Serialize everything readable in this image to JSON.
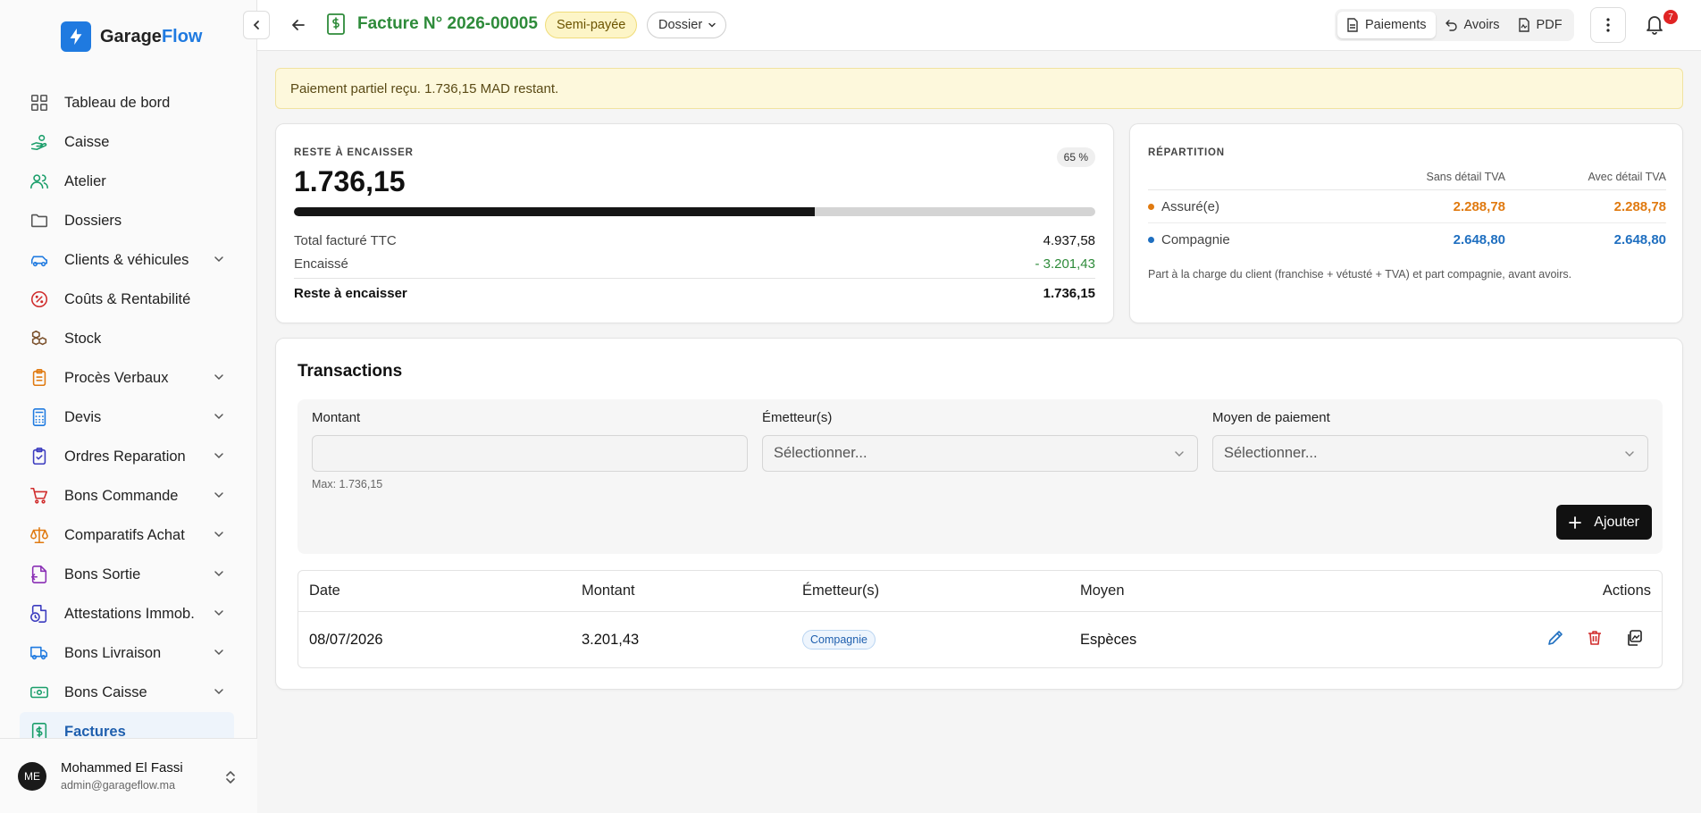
{
  "app": {
    "brand_1": "Garage",
    "brand_2": "Flow",
    "accent": "#1f7ae0"
  },
  "sidebar": {
    "items": [
      {
        "label": "Tableau de bord",
        "icon": "dashboard-icon",
        "color": "#555555",
        "chevron": false
      },
      {
        "label": "Caisse",
        "icon": "cash-hand-icon",
        "color": "#1a9e6a",
        "chevron": false
      },
      {
        "label": "Atelier",
        "icon": "users-icon",
        "color": "#1a9e6a",
        "chevron": false
      },
      {
        "label": "Dossiers",
        "icon": "folder-icon",
        "color": "#555555",
        "chevron": false
      },
      {
        "label": "Clients & véhicules",
        "icon": "car-icon",
        "color": "#1f7ae0",
        "chevron": true
      },
      {
        "label": "Coûts & Rentabilité",
        "icon": "percent-icon",
        "color": "#d02c2c",
        "chevron": false
      },
      {
        "label": "Stock",
        "icon": "boxes-icon",
        "color": "#7a4f2a",
        "chevron": false
      },
      {
        "label": "Procès Verbaux",
        "icon": "clipboard-list-icon",
        "color": "#e07a10",
        "chevron": true
      },
      {
        "label": "Devis",
        "icon": "calculator-icon",
        "color": "#1f7ae0",
        "chevron": true
      },
      {
        "label": "Ordres Reparation",
        "icon": "clipboard-check-icon",
        "color": "#3b3bbf",
        "chevron": true
      },
      {
        "label": "Bons Commande",
        "icon": "cart-icon",
        "color": "#d02c2c",
        "chevron": true
      },
      {
        "label": "Comparatifs Achat",
        "icon": "scale-icon",
        "color": "#e07a10",
        "chevron": true
      },
      {
        "label": "Bons Sortie",
        "icon": "file-export-icon",
        "color": "#8a2fb5",
        "chevron": true
      },
      {
        "label": "Attestations Immob.",
        "icon": "file-clock-icon",
        "color": "#3b3bbf",
        "chevron": true
      },
      {
        "label": "Bons Livraison",
        "icon": "truck-icon",
        "color": "#1f7ae0",
        "chevron": true
      },
      {
        "label": "Bons Caisse",
        "icon": "banknote-icon",
        "color": "#1a9e6a",
        "chevron": true
      },
      {
        "label": "Factures",
        "icon": "invoice-icon",
        "color": "#1a9e6a",
        "chevron": false,
        "active": true
      }
    ],
    "user": {
      "initials": "ME",
      "name": "Mohammed El Fassi",
      "email": "admin@garageflow.ma"
    }
  },
  "header": {
    "title": "Facture N° 2026-00005",
    "status": "Semi-payée",
    "dossier_label": "Dossier",
    "tabs": [
      {
        "label": "Paiements",
        "icon": "file-icon",
        "active": true
      },
      {
        "label": "Avoirs",
        "icon": "undo-icon",
        "active": false
      },
      {
        "label": "PDF",
        "icon": "pdf-icon",
        "active": false
      }
    ],
    "notifications": "7"
  },
  "alert": {
    "text": "Paiement partiel reçu. 1.736,15 MAD restant."
  },
  "balance": {
    "eyebrow": "RESTE À ENCAISSER",
    "percent_label": "65 %",
    "paid_fraction": 0.65,
    "amount": "1.736,15",
    "rows": {
      "total_label": "Total facturé TTC",
      "total_value": "4.937,58",
      "paid_label": "Encaissé",
      "paid_value": "- 3.201,43",
      "remaining_label": "Reste à encaisser",
      "remaining_value": "1.736,15"
    }
  },
  "repartition": {
    "eyebrow": "RÉPARTITION",
    "col1": "Sans détail TVA",
    "col2": "Avec détail TVA",
    "rows": [
      {
        "label": "Assuré(e)",
        "v1": "2.288,78",
        "v2": "2.288,78",
        "color": "#e07a10"
      },
      {
        "label": "Compagnie",
        "v1": "2.648,80",
        "v2": "2.648,80",
        "color": "#1f6fc0"
      }
    ],
    "note": "Part à la charge du client (franchise + vétusté + TVA) et part compagnie, avant avoirs."
  },
  "transactions": {
    "title": "Transactions",
    "form": {
      "amount_label": "Montant",
      "amount_value": "",
      "amount_hint": "Max: 1.736,15",
      "issuer_label": "Émetteur(s)",
      "issuer_placeholder": "Sélectionner...",
      "method_label": "Moyen de paiement",
      "method_placeholder": "Sélectionner...",
      "add_label": "Ajouter"
    },
    "columns": {
      "date": "Date",
      "amount": "Montant",
      "issuer": "Émetteur(s)",
      "method": "Moyen",
      "actions": "Actions"
    },
    "rows": [
      {
        "date": "08/07/2026",
        "amount": "3.201,43",
        "issuer": "Compagnie",
        "method": "Espèces"
      }
    ]
  }
}
